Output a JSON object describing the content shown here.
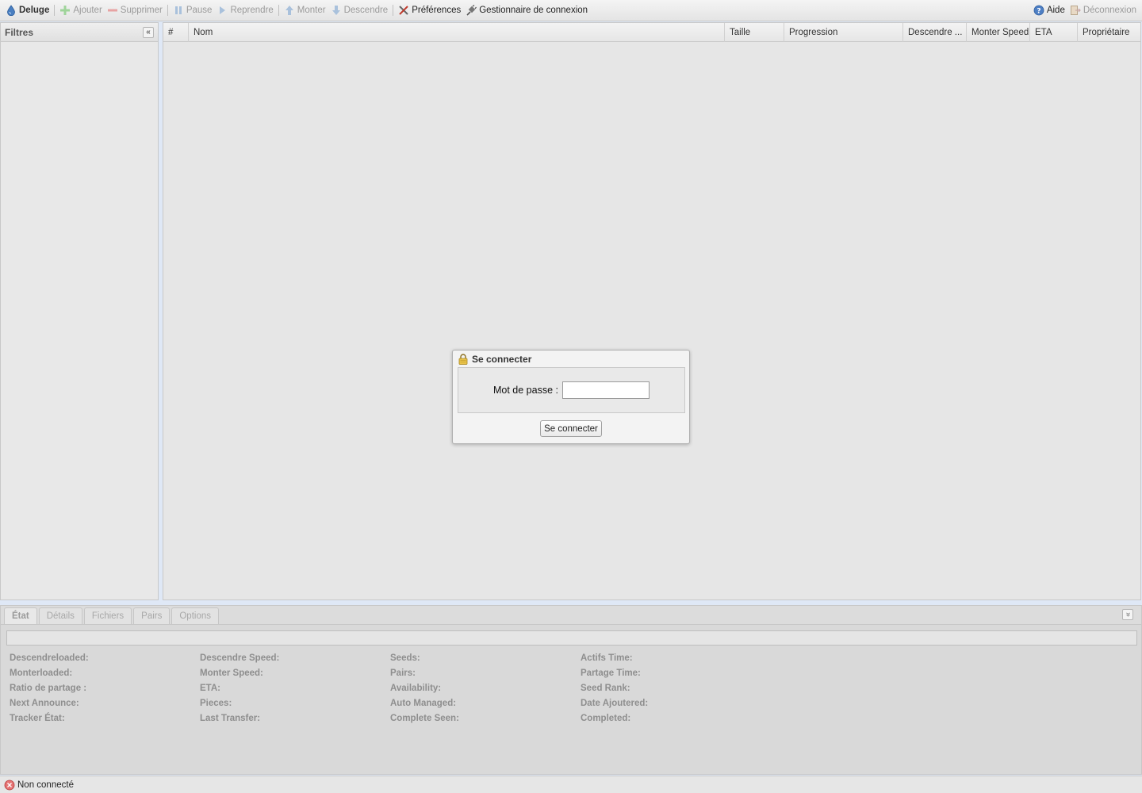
{
  "toolbar": {
    "brand": "Deluge",
    "add": "Ajouter",
    "remove": "Supprimer",
    "pause": "Pause",
    "resume": "Reprendre",
    "up": "Monter",
    "down": "Descendre",
    "preferences": "Préférences",
    "connection_manager": "Gestionnaire de connexion",
    "help": "Aide",
    "logout": "Déconnexion"
  },
  "filters": {
    "title": "Filtres"
  },
  "grid": {
    "columns": [
      {
        "label": "#"
      },
      {
        "label": "Nom"
      },
      {
        "label": "Taille"
      },
      {
        "label": "Progression"
      },
      {
        "label": "Descendre ..."
      },
      {
        "label": "Monter Speed"
      },
      {
        "label": "ETA"
      },
      {
        "label": "Propriétaire"
      }
    ]
  },
  "login": {
    "title": "Se connecter",
    "password_label": "Mot de passe :",
    "password_value": "",
    "submit": "Se connecter"
  },
  "details": {
    "tabs": [
      "État",
      "Détails",
      "Fichiers",
      "Pairs",
      "Options"
    ],
    "active_tab": "État",
    "col1": [
      "Descendreloaded:",
      "Monterloaded:",
      "Ratio de partage :",
      "Next Announce:",
      "Tracker État:"
    ],
    "col2": [
      "Descendre Speed:",
      "Monter Speed:",
      "ETA:",
      "Pieces:",
      "Last Transfer:"
    ],
    "col3": [
      "Seeds:",
      "Pairs:",
      "Availability:",
      "Auto Managed:",
      "Complete Seen:"
    ],
    "col4": [
      "Actifs Time:",
      "Partage Time:",
      "Seed Rank:",
      "Date Ajoutered:",
      "Completed:"
    ]
  },
  "status": {
    "connection": "Non connecté"
  },
  "icons": {
    "brand": "deluge-drop-icon",
    "add": "plus-icon",
    "remove": "minus-icon",
    "pause": "pause-icon",
    "resume": "play-icon",
    "up": "arrow-up-icon",
    "down": "arrow-down-icon",
    "preferences": "tools-icon",
    "connection_manager": "plug-icon",
    "help": "help-icon",
    "logout": "logout-icon",
    "lock": "lock-icon",
    "status": "disconnected-icon"
  }
}
